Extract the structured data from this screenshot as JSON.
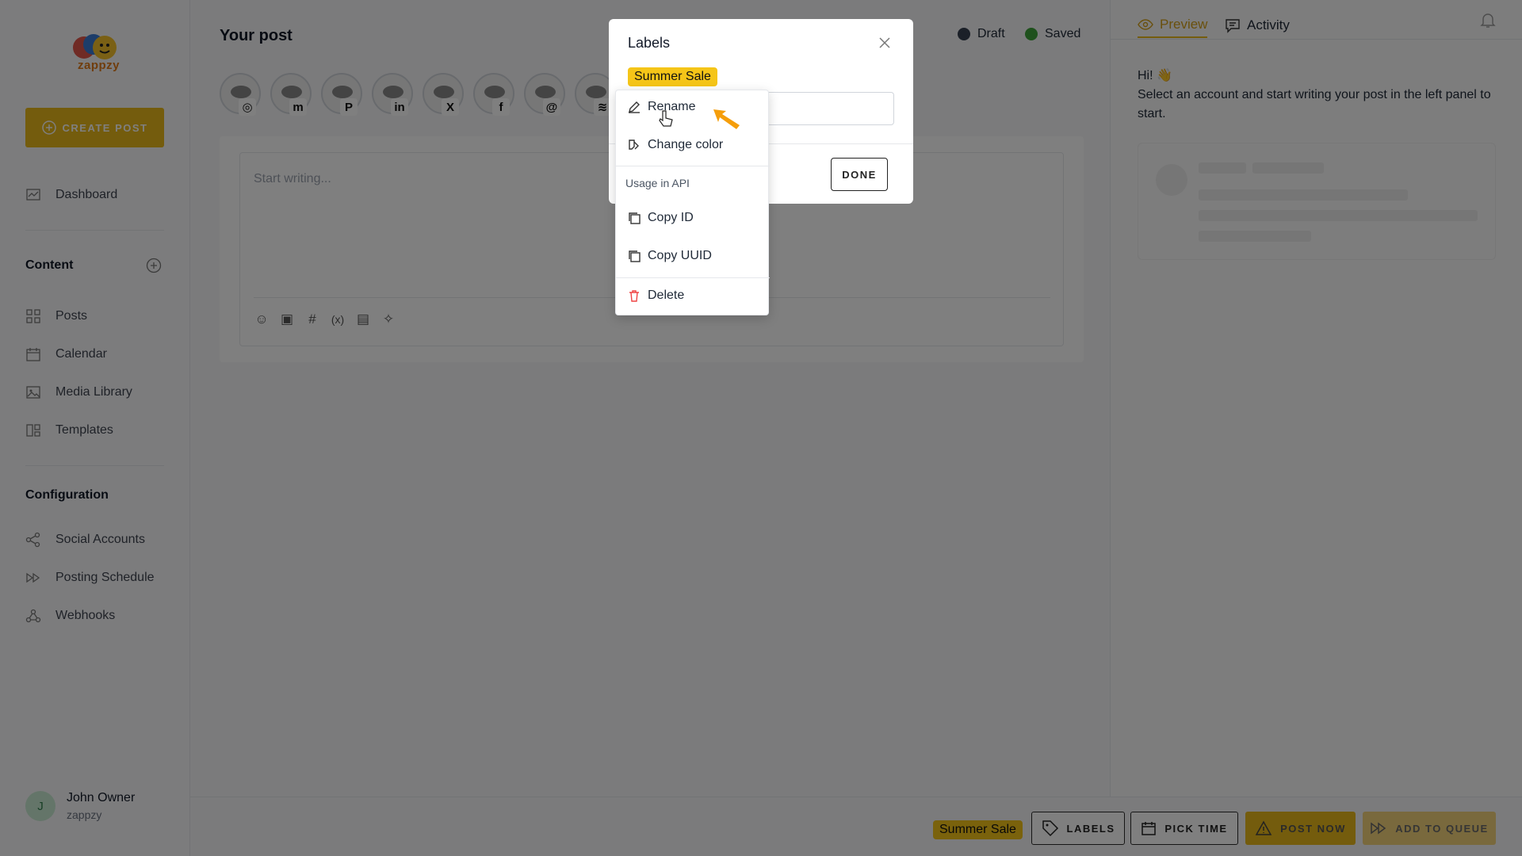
{
  "sidebar": {
    "logo_text": "zappzy",
    "create_post_label": "CREATE POST",
    "items": [
      {
        "label": "Dashboard"
      },
      {
        "label": "Posts"
      },
      {
        "label": "Calendar"
      },
      {
        "label": "Media Library"
      },
      {
        "label": "Templates"
      },
      {
        "label": "Social Accounts"
      },
      {
        "label": "Posting Schedule"
      },
      {
        "label": "Webhooks"
      }
    ],
    "sections": {
      "content": "Content",
      "configuration": "Configuration"
    },
    "user": {
      "initial": "J",
      "name": "John Owner",
      "org": "zappzy"
    }
  },
  "main": {
    "title": "Your post",
    "status_draft": "Draft",
    "status_saved": "Saved",
    "editor_placeholder": "Start writing...",
    "accounts": [
      {
        "network": "instagram-icon",
        "glyph": "◎"
      },
      {
        "network": "mastodon-icon",
        "glyph": "m"
      },
      {
        "network": "pinterest-icon",
        "glyph": "P"
      },
      {
        "network": "linkedin-icon",
        "glyph": "in"
      },
      {
        "network": "x-icon",
        "glyph": "X"
      },
      {
        "network": "facebook-icon",
        "glyph": "f"
      },
      {
        "network": "threads-icon",
        "glyph": "@"
      },
      {
        "network": "bluesky-icon",
        "glyph": "≋"
      }
    ]
  },
  "right_panel": {
    "tabs": [
      {
        "label": "Preview"
      },
      {
        "label": "Activity"
      }
    ],
    "preview_greeting": "Hi! 👋",
    "preview_text": "Select an account and start writing your post in the left panel to start."
  },
  "bottom_bar": {
    "label_tag": "Summer Sale",
    "labels_button": "LABELS",
    "pick_time_button": "PICK TIME",
    "post_now_button": "POST NOW",
    "add_to_queue_button": "ADD TO QUEUE"
  },
  "modal": {
    "title": "Labels",
    "tag": "Summer Sale",
    "done_button": "DONE"
  },
  "context_menu": {
    "rename": "Rename",
    "change_color": "Change color",
    "section_api": "Usage in API",
    "copy_id": "Copy ID",
    "copy_uuid": "Copy UUID",
    "delete": "Delete"
  },
  "colors": {
    "accent": "#e8b81a",
    "tag": "#f5c518",
    "saved": "#3fa33a",
    "draft": "#374151",
    "delete": "#ef4444",
    "arrow": "#f59e0b"
  }
}
